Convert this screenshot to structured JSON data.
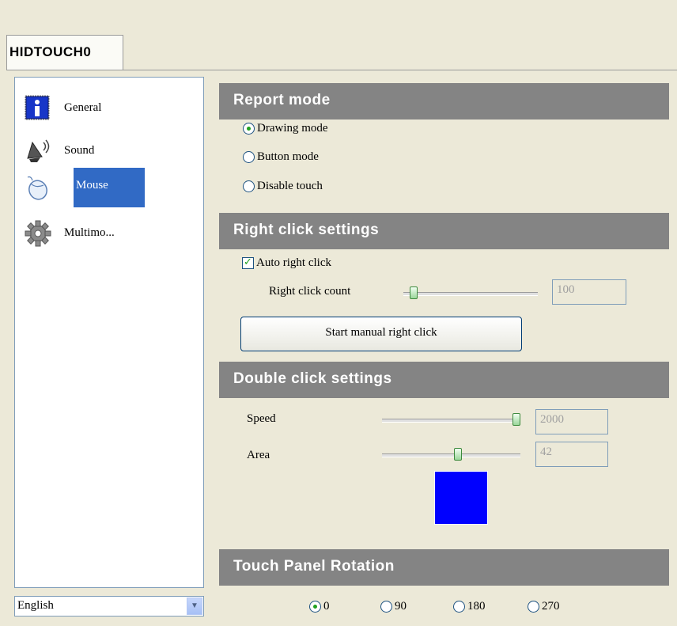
{
  "tab": {
    "label": "HIDTOUCH0"
  },
  "sidebar": {
    "items": [
      {
        "label": "General",
        "icon": "info-icon",
        "selected": false
      },
      {
        "label": "Sound",
        "icon": "speaker-icon",
        "selected": false
      },
      {
        "label": "Mouse",
        "icon": "mouse-icon",
        "selected": true
      },
      {
        "label": "Multimo...",
        "icon": "gear-icon",
        "selected": false
      }
    ],
    "language": {
      "value": "English"
    }
  },
  "report_mode": {
    "title": "Report mode",
    "options": [
      {
        "label": "Drawing mode",
        "checked": true
      },
      {
        "label": "Button mode",
        "checked": false
      },
      {
        "label": "Disable touch",
        "checked": false
      }
    ]
  },
  "right_click": {
    "title": "Right click settings",
    "auto_label": "Auto right click",
    "auto_checked": true,
    "count_label": "Right click count",
    "count_value": "100",
    "count_slider_fraction": 0.05,
    "manual_button": "Start manual right click"
  },
  "double_click": {
    "title": "Double click settings",
    "speed_label": "Speed",
    "speed_value": "2000",
    "speed_slider_fraction": 1.0,
    "area_label": "Area",
    "area_value": "42",
    "area_slider_fraction": 0.55,
    "swatch_color": "#0000ff"
  },
  "rotation": {
    "title": "Touch Panel Rotation",
    "options": [
      {
        "label": "0",
        "checked": true
      },
      {
        "label": "90",
        "checked": false
      },
      {
        "label": "180",
        "checked": false
      },
      {
        "label": "270",
        "checked": false
      }
    ]
  },
  "colors": {
    "header_bg": "#848484",
    "selection": "#316ac5",
    "window_bg": "#ece9d8"
  }
}
